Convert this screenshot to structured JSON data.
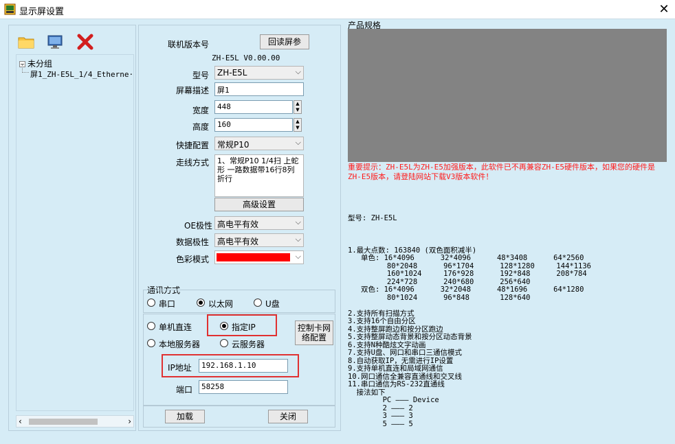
{
  "window": {
    "title": "显示屏设置"
  },
  "toolbar": {
    "icons": [
      "folder-icon",
      "monitor-icon",
      "delete-icon"
    ]
  },
  "tree": {
    "root": "未分组",
    "child": "屏1_ZH-E5L_1/4_Etherne·"
  },
  "form": {
    "version_label": "联机版本号",
    "readback_button": "回读屏参",
    "version_value": "ZH-E5L V0.00.00",
    "model_label": "型号",
    "model_value": "ZH-E5L",
    "desc_label": "屏幕描述",
    "desc_value": "屏1",
    "width_label": "宽度",
    "width_value": "448",
    "height_label": "高度",
    "height_value": "160",
    "quick_label": "快捷配置",
    "quick_value": "常规P10",
    "wiring_label": "走线方式",
    "wiring_value": "1、常规P10 1/4扫 上蛇形 一路数据带16行8列折行",
    "advanced_button": "高级设置",
    "oe_label": "OE极性",
    "oe_value": "高电平有效",
    "data_label": "数据极性",
    "data_value": "高电平有效",
    "color_label": "色彩模式",
    "color_value": "#ff0000"
  },
  "comm": {
    "title": "通讯方式",
    "options": [
      "串口",
      "以太网",
      "U盘"
    ],
    "selected": "以太网",
    "mode_options": [
      "单机直连",
      "指定IP",
      "本地服务器",
      "云服务器"
    ],
    "mode_selected": "指定IP",
    "config_button": "控制卡网络配置",
    "ip_label": "IP地址",
    "ip_value": "192.168.1.10",
    "port_label": "端口",
    "port_value": "58258"
  },
  "footer": {
    "load_button": "加载",
    "close_button": "关闭"
  },
  "spec": {
    "title": "产品规格",
    "warning": "重要提示：ZH-E5L为ZH-E5加强版本，此软件已不再兼容ZH-E5硬件版本，如果您的硬件是ZH-E5版本，请登陆网站下载V3版本软件！",
    "model_line": "型号: ZH-E5L",
    "lines": [
      "1.最大点数: 163840 (双色面积减半)",
      "   单色: 16*4096      32*4096      48*3408      64*2560",
      "         80*2048      96*1704      128*1280     144*1136",
      "         160*1024     176*928      192*848      208*784",
      "         224*728      240*680      256*640",
      "   双色: 16*4096      32*2048      48*1696      64*1280",
      "         80*1024      96*848       128*640",
      "",
      "2.支持所有扫描方式",
      "3.支持16个自由分区",
      "4.支持整屏跑边和按分区跑边",
      "5.支持整屏动态背景和按分区动态背景",
      "6.支持N种酷炫文字动画",
      "7.支持U盘、网口和串口三通信模式",
      "8.自动获取IP，无需进行IP设置",
      "9.支持单机直连和局域网通信",
      "10.网口通信全兼容直通线和交叉线",
      "11.串口通信为RS-232直通线",
      "  接法如下",
      "        PC ——— Device",
      "        2 ——— 2",
      "        3 ——— 3",
      "        5 ——— 5"
    ]
  }
}
